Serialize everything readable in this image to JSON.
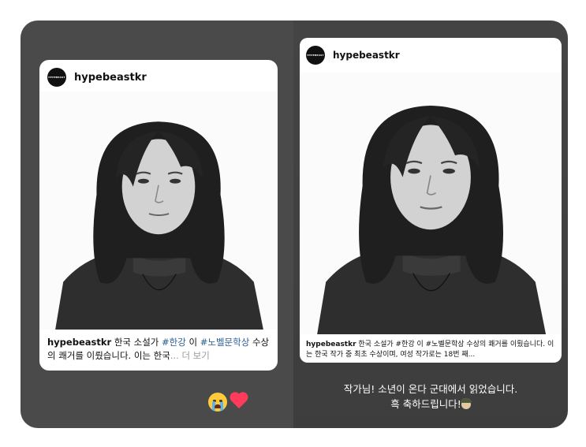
{
  "left_post": {
    "logo_text": "HYPEBEAST",
    "username": "hypebeastkr",
    "caption": {
      "username": "hypebeastkr",
      "text1": " 한국 소설가 ",
      "tag1": "#한강",
      "text2": " 이 ",
      "tag2": "#노벨문학상",
      "text3": " 수상의 쾌거를 이뤘습니다. 이는 한국",
      "more": "... 더 보기"
    },
    "reactions": [
      "crying-face",
      "red-heart"
    ]
  },
  "right_post": {
    "logo_text": "HYPEBEAST",
    "username": "hypebeastkr",
    "caption": {
      "username": "hypebeastkr",
      "text": " 한국 소설가 #한강 이 #노벨문학상 수상의 쾌거를 이뤘습니다. 이는 한국 작가 중 최초 수상이며, 여성 작가로는 18번 째..."
    },
    "story_text": {
      "line1": "작가님! 소년이 온다 군대에서 읽었습니다.",
      "line2": "흑 축하드립니다!"
    }
  },
  "colors": {
    "left_bg": "#4a4a4a",
    "right_bg": "#3f3f3f",
    "hashtag": "#2b5e94"
  }
}
